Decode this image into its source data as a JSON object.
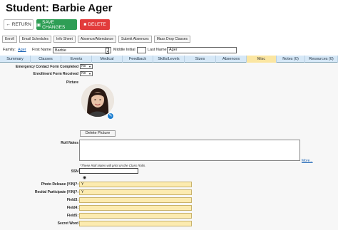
{
  "page": {
    "title": "Student: Barbie Ager"
  },
  "actions": {
    "return_label": "RETURN",
    "save_label": "SAVE CHANGES",
    "delete_label": "DELETE"
  },
  "subnav": [
    "Enroll",
    "Email Schedules",
    "Info Sheet",
    "Absence/Attendance",
    "Submit Absences",
    "Mass Drop Classes"
  ],
  "family": {
    "family_label": "Family:",
    "family_link": "Ager",
    "first_name_label": "First Name",
    "first_name": "Barbie",
    "middle_initial_label": "Middle Initial",
    "middle_initial": "",
    "last_name_label": "Last Name",
    "last_name": "Ager"
  },
  "tabs": [
    {
      "label": "Summary"
    },
    {
      "label": "Classes"
    },
    {
      "label": "Events"
    },
    {
      "label": "Medical"
    },
    {
      "label": "Feedback"
    },
    {
      "label": "Skills/Levels"
    },
    {
      "label": "Sizes"
    },
    {
      "label": "Absences"
    },
    {
      "label": "Misc",
      "active": true
    },
    {
      "label": "Notes (0)"
    },
    {
      "label": "Resources (0)"
    }
  ],
  "misc": {
    "emergency_label": "Emergency Contact Form Completed",
    "emergency_value": "No",
    "enrollment_label": "Enrollment Form Received",
    "enrollment_value": "No",
    "picture_label": "Picture",
    "delete_picture_label": "Delete Picture",
    "roll_notes_label": "Roll Notes",
    "roll_notes_value": "",
    "more_label": "More...",
    "roll_notes_hint": "*These Roll Notes will print on the Class Rolls.",
    "ssn_label": "SSN",
    "photo_release_label": "Photo Release (Y/N)?:",
    "photo_release_value": "Y",
    "recital_label": "Recital Participate (Y/N)?:",
    "recital_value": "Y",
    "field3_label": "Field3:",
    "field3_value": "",
    "field4_label": "Field4:",
    "field4_value": "",
    "field5_label": "Field5:",
    "field5_value": "",
    "secret_label": "Secret Word",
    "secret_value": ""
  },
  "colors": {
    "save": "#2e9e55",
    "delete": "#e23c3c",
    "tab_bar": "#d6e8f7",
    "active_tab": "#fbe6a2",
    "link": "#1a63b5",
    "custom_field": "#fcebb0"
  },
  "icons": {
    "return": "arrow-left-icon",
    "save": "save-icon",
    "delete": "trash-icon",
    "edit_photo": "pencil-icon",
    "ssn_reveal": "eye-icon",
    "lookup": "search-icon"
  }
}
